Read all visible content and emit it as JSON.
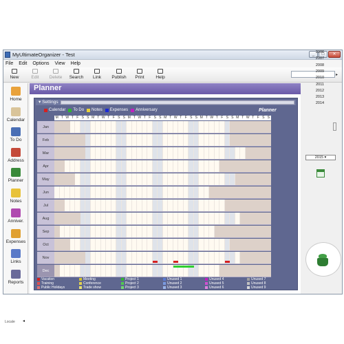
{
  "window": {
    "title": "MyUltimateOrganizer - Test",
    "buttons": [
      "_",
      "□",
      "✕"
    ]
  },
  "menu": [
    "File",
    "Edit",
    "Options",
    "View",
    "Help"
  ],
  "toolbar": [
    {
      "label": "New",
      "icon": "new-icon",
      "enabled": true
    },
    {
      "label": "Edit",
      "icon": "edit-icon",
      "enabled": false
    },
    {
      "label": "Delete",
      "icon": "delete-icon",
      "enabled": false
    },
    {
      "label": "Search",
      "icon": "search-icon",
      "enabled": true
    },
    {
      "label": "Link",
      "icon": "link-icon",
      "enabled": true
    },
    {
      "label": "Publish",
      "icon": "publish-icon",
      "enabled": true
    },
    {
      "label": "Print",
      "icon": "print-icon",
      "enabled": true
    },
    {
      "label": "Help",
      "icon": "help-icon",
      "enabled": true
    }
  ],
  "search": {
    "placeholder": ""
  },
  "sidebar": {
    "items": [
      {
        "label": "Home",
        "icon": "home-icon",
        "color": "#e9a23b"
      },
      {
        "label": "Calendar",
        "icon": "calendar-icon",
        "color": "#d9c49a"
      },
      {
        "label": "To Do",
        "icon": "todo-icon",
        "color": "#4a6fb5"
      },
      {
        "label": "Address",
        "icon": "address-icon",
        "color": "#c44a3a"
      },
      {
        "label": "Planner",
        "icon": "planner-icon",
        "color": "#3a8a3a"
      },
      {
        "label": "Notes",
        "icon": "notes-icon",
        "color": "#e8c23a"
      },
      {
        "label": "Anniver.",
        "icon": "anniversary-icon",
        "color": "#b04ab0"
      },
      {
        "label": "Expenses",
        "icon": "expenses-icon",
        "color": "#e0a030"
      },
      {
        "label": "Links",
        "icon": "links-icon",
        "color": "#5a7ac8"
      },
      {
        "label": "Reports",
        "icon": "reports-icon",
        "color": "#6a6a9a"
      }
    ],
    "status": "Locale"
  },
  "planner": {
    "title": "Planner",
    "settings_label": "Settings",
    "watermark": "Planner",
    "legend_top": [
      {
        "label": "Calendar",
        "color": "#d62020"
      },
      {
        "label": "To Do",
        "color": "#2fb52f"
      },
      {
        "label": "Notes",
        "color": "#e8d23a"
      },
      {
        "label": "Expenses",
        "color": "#1a2ad8"
      },
      {
        "label": "Anniversary",
        "color": "#c020c0"
      }
    ],
    "day_headers": [
      "M",
      "T",
      "W",
      "T",
      "F",
      "S",
      "S",
      "M",
      "T",
      "W",
      "T",
      "F",
      "S",
      "S",
      "M",
      "T",
      "W",
      "T",
      "F",
      "S",
      "S",
      "M",
      "T",
      "W",
      "T",
      "F",
      "S",
      "S",
      "M",
      "T",
      "W",
      "T",
      "F",
      "S",
      "S",
      "M",
      "T",
      "W",
      "T",
      "F",
      "S",
      "S"
    ],
    "months": [
      {
        "name": "Jan",
        "start": 3,
        "days": 31
      },
      {
        "name": "Feb",
        "start": 6,
        "days": 28
      },
      {
        "name": "Mar",
        "start": 6,
        "days": 31
      },
      {
        "name": "Apr",
        "start": 2,
        "days": 30
      },
      {
        "name": "May",
        "start": 4,
        "days": 31
      },
      {
        "name": "Jun",
        "start": 0,
        "days": 30
      },
      {
        "name": "Jul",
        "start": 2,
        "days": 31
      },
      {
        "name": "Aug",
        "start": 5,
        "days": 31
      },
      {
        "name": "Sep",
        "start": 1,
        "days": 30
      },
      {
        "name": "Oct",
        "start": 3,
        "days": 31
      },
      {
        "name": "Nov",
        "start": 6,
        "days": 30
      },
      {
        "name": "Dec",
        "start": 1,
        "days": 31
      }
    ],
    "current_month": "Dec",
    "events": [
      {
        "month": "Nov",
        "col": 19,
        "span": 1,
        "color": "#d62020",
        "lane": "bottom"
      },
      {
        "month": "Nov",
        "col": 23,
        "span": 1,
        "color": "#d62020",
        "lane": "bottom"
      },
      {
        "month": "Nov",
        "col": 33,
        "span": 1,
        "color": "#d62020",
        "lane": "bottom"
      },
      {
        "month": "Dec",
        "col": 23,
        "span": 4,
        "color": "#2fd02f",
        "lane": "top"
      }
    ],
    "legend_bottom": [
      {
        "label": "Vacation",
        "color": "#d62020"
      },
      {
        "label": "Training",
        "color": "#e05050"
      },
      {
        "label": "Public Holidays",
        "color": "#e07070"
      },
      {
        "label": "Meeting",
        "color": "#d0c030"
      },
      {
        "label": "Conference",
        "color": "#e0d050"
      },
      {
        "label": "Trade show",
        "color": "#e8e070"
      },
      {
        "label": "Project 1",
        "color": "#2fb52f"
      },
      {
        "label": "Project 2",
        "color": "#50c850"
      },
      {
        "label": "Project 3",
        "color": "#70d870"
      },
      {
        "label": "Unused 1",
        "color": "#5a7ad0"
      },
      {
        "label": "Unused 2",
        "color": "#7a9ae0"
      },
      {
        "label": "Unused 3",
        "color": "#9ab4e8"
      },
      {
        "label": "Unused 4",
        "color": "#c020c0"
      },
      {
        "label": "Unused 5",
        "color": "#d050d0"
      },
      {
        "label": "Unused 6",
        "color": "#e080e0"
      },
      {
        "label": "Unused 7",
        "color": "#a0a0a0"
      },
      {
        "label": "Unused 8",
        "color": "#c0c0c0"
      },
      {
        "label": "Unused 9",
        "color": "#d8d8d8"
      }
    ]
  },
  "years": [
    "2006",
    "2007",
    "2008",
    "2009",
    "2010",
    "2011",
    "2012",
    "2013",
    "2014"
  ],
  "selected_year": "2015"
}
